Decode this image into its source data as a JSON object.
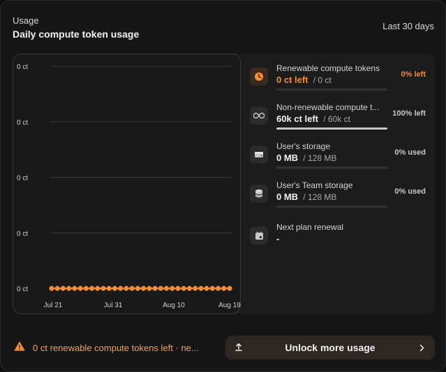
{
  "header": {
    "section": "Usage",
    "title": "Daily compute token usage",
    "range": "Last 30 days"
  },
  "chart_data": {
    "type": "line",
    "y_ticks": [
      "0 ct",
      "0 ct",
      "0 ct",
      "0 ct",
      "0 ct"
    ],
    "x_ticks": [
      "Jul 21",
      "Jul 31",
      "Aug 10",
      "Aug 19"
    ],
    "series": [
      {
        "values": [
          0,
          0,
          0,
          0,
          0,
          0,
          0,
          0,
          0,
          0,
          0,
          0,
          0,
          0,
          0,
          0,
          0,
          0,
          0,
          0,
          0,
          0,
          0,
          0,
          0,
          0,
          0,
          0,
          0,
          0,
          0,
          0
        ]
      }
    ],
    "ylim": [
      0,
      0
    ],
    "grid": true,
    "color": "#f08c3a"
  },
  "usage": [
    {
      "icon": "clock-icon",
      "name": "Renewable compute tokens",
      "value": "0 ct left",
      "total": "/ 0 ct",
      "percent": "0% left",
      "fill": 0,
      "accent": true
    },
    {
      "icon": "infinity-icon",
      "name": "Non-renewable compute t...",
      "value": "60k ct left",
      "total": "/ 60k ct",
      "percent": "100% left",
      "fill": 1,
      "accent": false
    },
    {
      "icon": "drive-icon",
      "name": "User's storage",
      "value": "0 MB",
      "total": "/ 128 MB",
      "percent": "0% used",
      "fill": 0,
      "accent": false
    },
    {
      "icon": "database-icon",
      "name": "User's Team storage",
      "value": "0 MB",
      "total": "/ 128 MB",
      "percent": "0% used",
      "fill": 0,
      "accent": false
    },
    {
      "icon": "calendar-icon",
      "name": "Next plan renewal",
      "value": "-"
    }
  ],
  "footer": {
    "warning": "0 ct renewable compute tokens left · ne...",
    "button": "Unlock more usage"
  },
  "colors": {
    "accent": "#f08c3a",
    "warning": "#f0a060",
    "button_bg": "#2e2620"
  }
}
